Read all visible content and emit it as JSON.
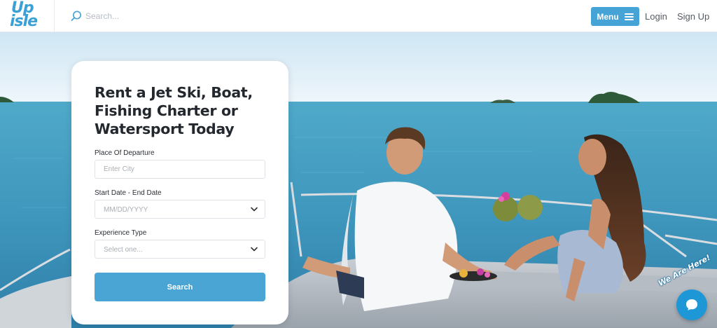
{
  "header": {
    "logo_line1": "Up",
    "logo_line2": "isle",
    "search": {
      "placeholder": "Search...",
      "value": "",
      "icon": "search-icon"
    },
    "menu_label": "Menu",
    "menu_icon": "hamburger-icon",
    "login_label": "Login",
    "signup_label": "Sign Up"
  },
  "booking": {
    "title": "Rent a Jet Ski, Boat, Fishing Charter or Watersport Today",
    "departure": {
      "label": "Place Of Departure",
      "placeholder": "Enter City",
      "value": ""
    },
    "dates": {
      "label": "Start Date - End Date",
      "placeholder": "MM/DD/YYYY",
      "icon": "chevron-down-icon"
    },
    "experience": {
      "label": "Experience Type",
      "selected": "Select one...",
      "icon": "chevron-down-icon"
    },
    "search_label": "Search"
  },
  "chat": {
    "label": "We Are Here!",
    "icon": "chat-bubble-icon"
  },
  "colors": {
    "brand": "#3aa0d6",
    "button": "#45a3d6",
    "search_button": "#4aa5d5",
    "chat": "#1e97d6"
  }
}
